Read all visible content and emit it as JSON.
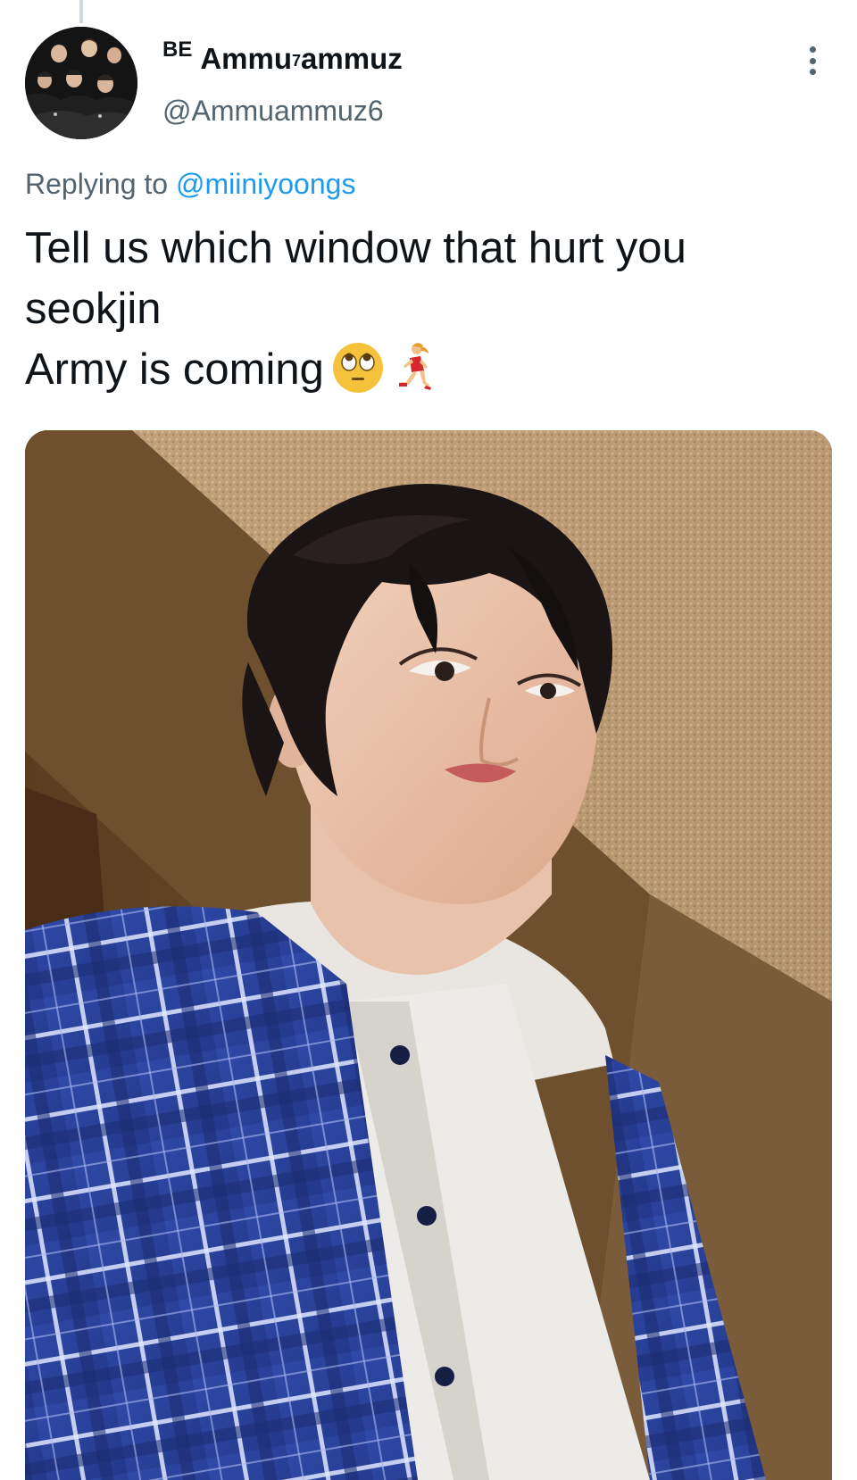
{
  "tweet": {
    "author": {
      "name_prefix": "BE",
      "name_main": "Ammu",
      "name_superscript": "7",
      "name_suffix": "ammuz",
      "handle": "@Ammuammuz6"
    },
    "reply": {
      "label": "Replying to",
      "target": "@miiniyoongs"
    },
    "text_lines": [
      "Tell us which window that hurt you",
      "seokjin",
      "Army is coming"
    ],
    "emojis": [
      "face-with-rolling-eyes-icon",
      "woman-running-icon"
    ],
    "media": {
      "kind": "photo"
    }
  },
  "colors": {
    "text_primary": "#0f1419",
    "text_secondary": "#536471",
    "link": "#1d9bf0",
    "thread_line": "#cfd9de"
  }
}
